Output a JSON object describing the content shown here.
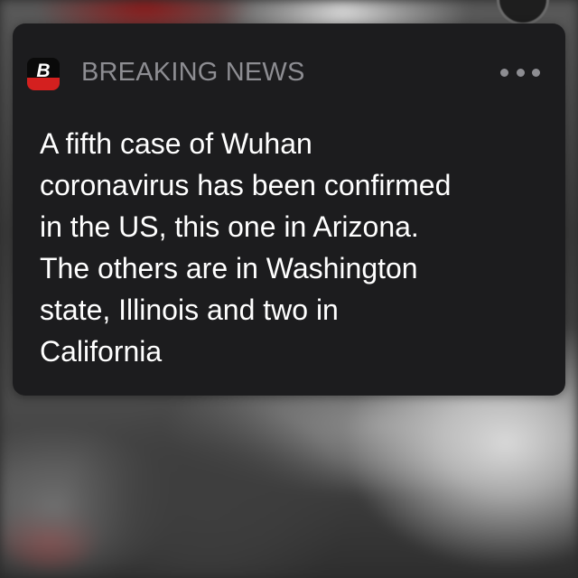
{
  "notification": {
    "app_name": "BREAKING NEWS",
    "app_icon": {
      "name": "breaking-news-app-icon",
      "letter": "B",
      "colors": {
        "top": "#0a0a0a",
        "bottom": "#d4201f",
        "letter": "#ffffff"
      }
    },
    "more_icon": "ellipsis-icon",
    "message": "A fifth case of Wuhan\ncoronavirus has been confirmed\nin the US, this one in Arizona.\nThe others are in Washington\nstate, Illinois and two in\nCalifornia"
  },
  "colors": {
    "card_background": "#1c1c1e",
    "secondary_text": "#8d8d92",
    "primary_text": "#ffffff"
  }
}
